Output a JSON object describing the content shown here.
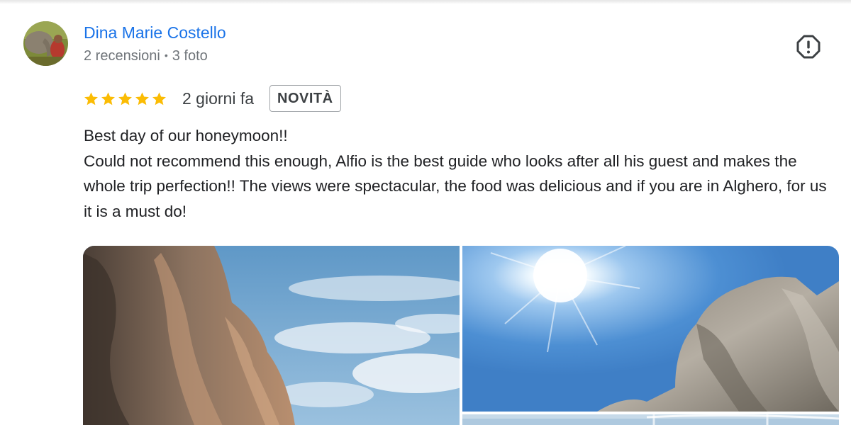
{
  "review": {
    "reviewer_name": "Dina Marie Costello",
    "reviews_count": "2 recensioni",
    "separator": "•",
    "photos_count": "3 foto",
    "rating": 5,
    "rating_max": 5,
    "date": "2 giorni fa",
    "badge": "NOVITÀ",
    "text_lines": [
      "Best day of our honeymoon!!",
      "Could not recommend this enough, Alfio is the best guide who looks after all his guest and makes the whole trip perfection!! The views were spectacular, the food was delicious and if you are in Alghero, for us it is a must do!"
    ]
  },
  "icons": {
    "report": "report-flag-icon",
    "star": "star-icon"
  },
  "colors": {
    "name_link": "#1a73e8",
    "star": "#fbbc04",
    "meta": "#70757a"
  }
}
